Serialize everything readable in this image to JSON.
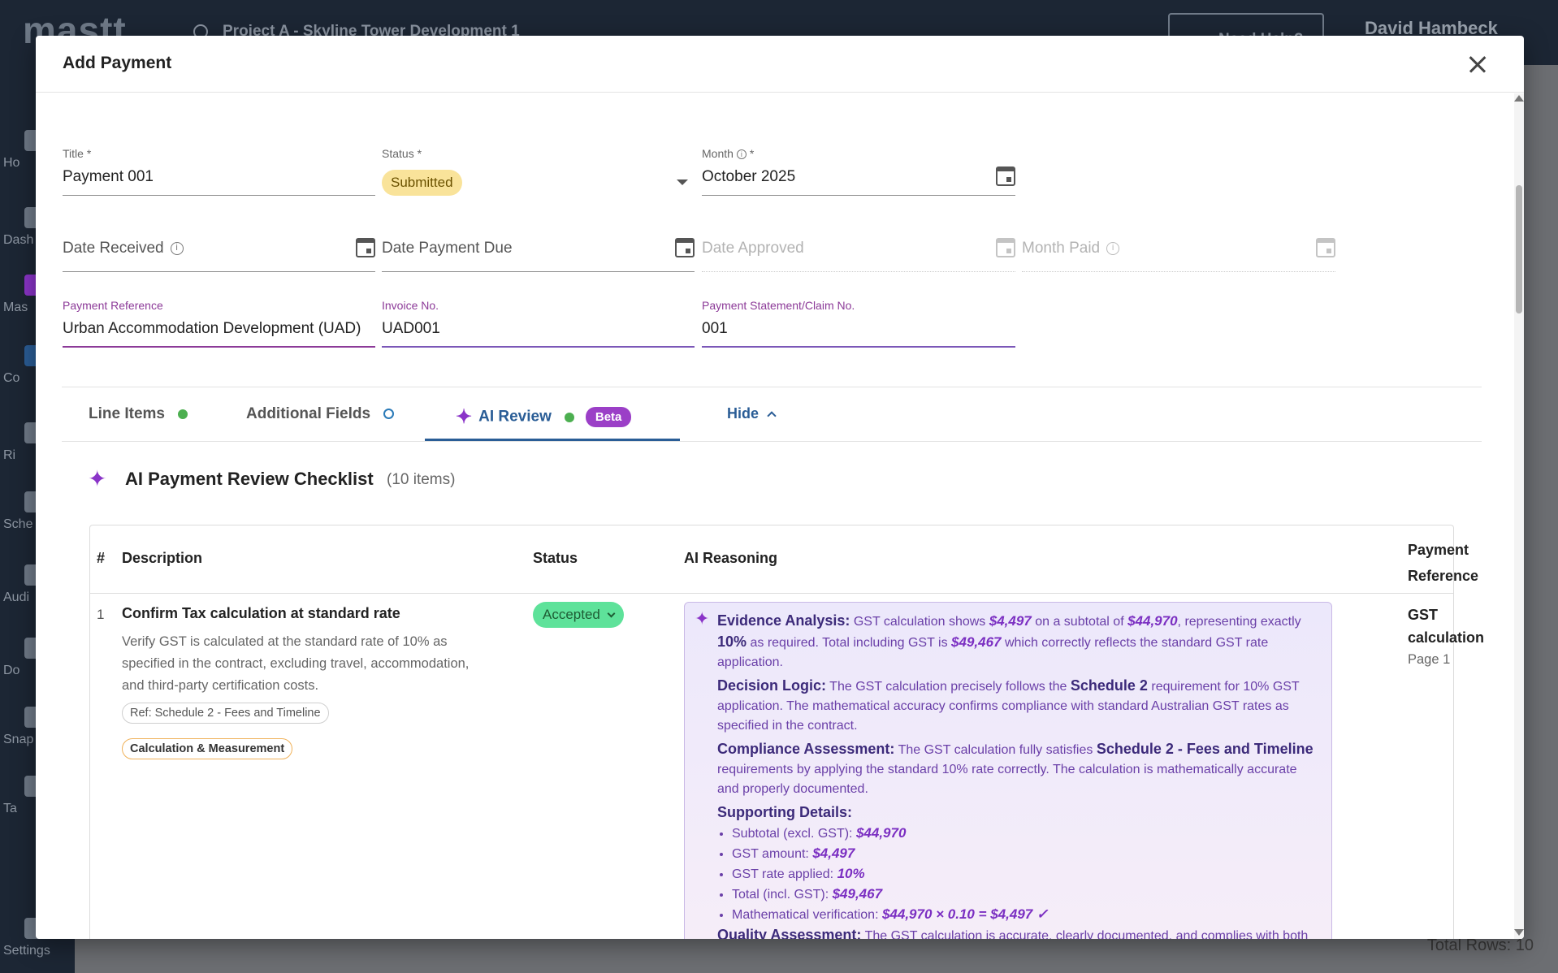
{
  "background": {
    "logo": "mastt",
    "project": "Project A - Skyline Tower Development 1",
    "help_label": "Need Help?",
    "user": "David Hambeck",
    "sidebar": [
      {
        "label": "Ho"
      },
      {
        "label": "Dash"
      },
      {
        "label": "Mas"
      },
      {
        "label": "Co"
      },
      {
        "label": "Ri"
      },
      {
        "label": "Sche"
      },
      {
        "label": "Audi"
      },
      {
        "label": "Do"
      },
      {
        "label": "Snap"
      },
      {
        "label": "Ta"
      },
      {
        "label": "Settings"
      }
    ],
    "total_rows": "Total Rows: 10"
  },
  "modal": {
    "title": "Add Payment",
    "fields": {
      "title": {
        "label": "Title *",
        "value": "Payment 001"
      },
      "status": {
        "label": "Status *",
        "value": "Submitted"
      },
      "month": {
        "label": "Month",
        "required": "*",
        "value": "October 2025"
      },
      "date_received": {
        "label": "Date Received"
      },
      "date_payment_due": {
        "label": "Date Payment Due"
      },
      "date_approved": {
        "label": "Date Approved"
      },
      "month_paid": {
        "label": "Month Paid"
      },
      "payment_reference": {
        "label": "Payment Reference",
        "value": "Urban Accommodation Development (UAD)"
      },
      "invoice_no": {
        "label": "Invoice No.",
        "value": "UAD001"
      },
      "claim_no": {
        "label": "Payment Statement/Claim No.",
        "value": "001"
      }
    },
    "tabs": {
      "line_items": "Line Items",
      "additional_fields": "Additional Fields",
      "ai_review": "AI Review",
      "beta": "Beta",
      "hide": "Hide"
    },
    "checklist": {
      "title": "AI Payment Review Checklist",
      "count": "(10 items)",
      "headers": {
        "num": "#",
        "description": "Description",
        "status": "Status",
        "reasoning": "AI Reasoning",
        "payment_reference": "Payment Reference"
      },
      "rows": [
        {
          "num": "1",
          "title": "Confirm Tax calculation at standard rate",
          "description": "Verify GST is calculated at the standard rate of 10% as specified in the contract, excluding travel, accommodation, and third-party certification costs.",
          "ref": "Ref: Schedule 2 - Fees and Timeline",
          "category": "Calculation & Measurement",
          "status": "Accepted",
          "reasoning": {
            "evidence_label": "Evidence Analysis:",
            "evidence_1": "GST calculation shows",
            "evidence_v1": "$4,497",
            "evidence_2": "on a subtotal of",
            "evidence_v2": "$44,970",
            "evidence_3": ", representing exactly",
            "evidence_v3": "10%",
            "evidence_4": "as required. Total including GST is",
            "evidence_v4": "$49,467",
            "evidence_5": "which correctly reflects the standard GST rate application.",
            "decision_label": "Decision Logic:",
            "decision_1": "The GST calculation precisely follows the",
            "decision_k1": "Schedule 2",
            "decision_2": "requirement for 10% GST application. The mathematical accuracy confirms compliance with standard Australian GST rates as specified in the contract.",
            "compliance_label": "Compliance Assessment:",
            "compliance_1": "The GST calculation fully satisfies",
            "compliance_k1": "Schedule 2 - Fees and Timeline",
            "compliance_2": "requirements by applying the standard 10% rate correctly. The calculation is mathematically accurate and properly documented.",
            "supporting_label": "Supporting Details:",
            "supporting": [
              {
                "label": "Subtotal (excl. GST):",
                "value": "$44,970"
              },
              {
                "label": "GST amount:",
                "value": "$4,497"
              },
              {
                "label": "GST rate applied:",
                "value": "10%"
              },
              {
                "label": "Total (incl. GST):",
                "value": "$49,467"
              },
              {
                "label": "Mathematical verification:",
                "value": "$44,970 × 0.10 = $4,497 ✓"
              }
            ],
            "quality_label": "Quality Assessment:",
            "quality_text": "The GST calculation is accurate, clearly documented, and complies with both contractual requirements and Australian taxation standards."
          },
          "payment_reference": "GST calculation",
          "page": "Page 1"
        }
      ]
    }
  }
}
